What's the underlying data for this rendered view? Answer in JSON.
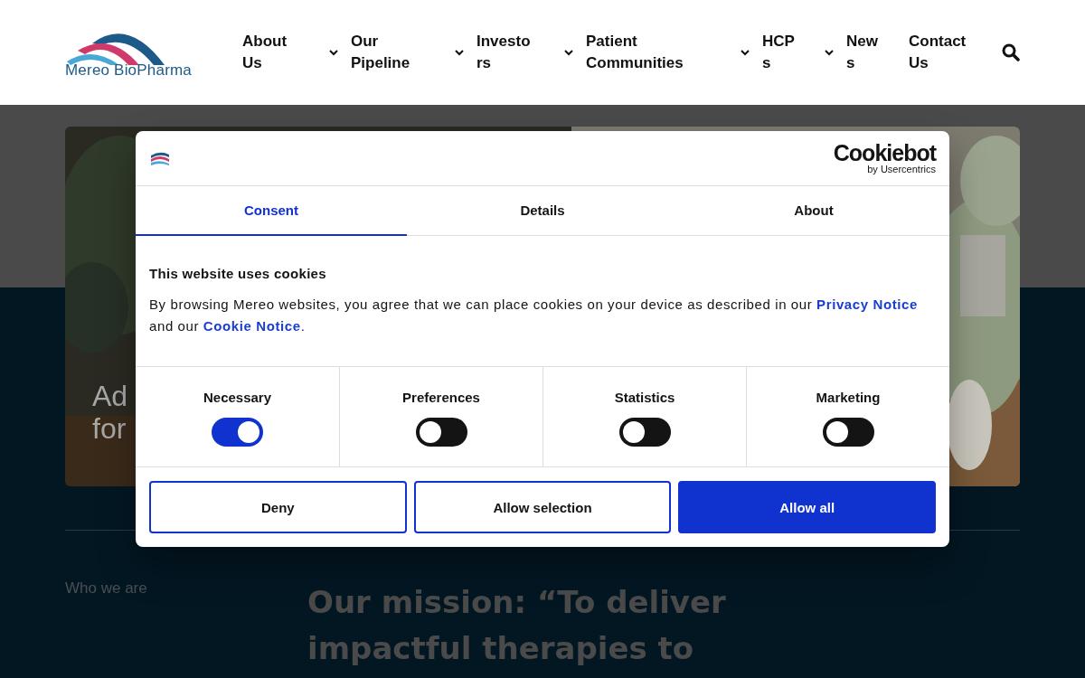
{
  "header": {
    "logo_text": "Mereo BioPharma",
    "nav": [
      {
        "label": "About Us",
        "dropdown": true
      },
      {
        "label": "Our Pipeline",
        "dropdown": true
      },
      {
        "label": "Investors",
        "dropdown": true
      },
      {
        "label": "Patient Communities",
        "dropdown": true
      },
      {
        "label": "HCPs",
        "dropdown": true
      },
      {
        "label": "News",
        "dropdown": false
      },
      {
        "label": "Contact Us",
        "dropdown": false
      }
    ]
  },
  "hero": {
    "kind": "picture",
    "title_lines": [
      "Ad",
      "for"
    ]
  },
  "section": {
    "eyebrow": "Who we are",
    "heading": "Our mission: “To deliver impactful therapies to"
  },
  "cookie_dialog": {
    "brand": "Cookiebot",
    "brand_sub": "by Usercentrics",
    "tabs": [
      {
        "label": "Consent",
        "selected": true
      },
      {
        "label": "Details",
        "selected": false
      },
      {
        "label": "About",
        "selected": false
      }
    ],
    "title": "This website uses cookies",
    "body": "By browsing Mereo websites, you agree that we can place cookies on your device as described in our ",
    "privacy_link": "Privacy Notice",
    "body_mid": " and our ",
    "cookie_link": "Cookie Notice",
    "body_end": ".",
    "categories": [
      {
        "label": "Necessary",
        "on": true
      },
      {
        "label": "Preferences",
        "on": false
      },
      {
        "label": "Statistics",
        "on": false
      },
      {
        "label": "Marketing",
        "on": false
      }
    ],
    "buttons": [
      {
        "label": "Deny",
        "kind": "outline"
      },
      {
        "label": "Allow selection",
        "kind": "outline"
      },
      {
        "label": "Allow all",
        "kind": "primary"
      }
    ]
  }
}
